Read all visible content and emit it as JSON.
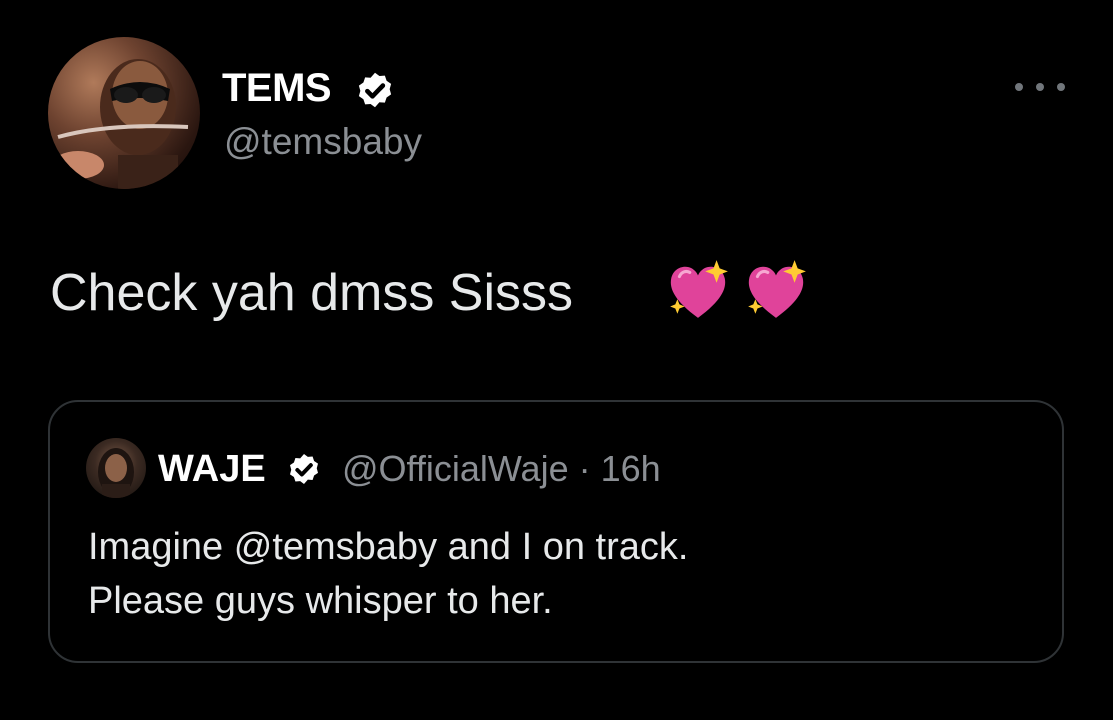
{
  "tweet": {
    "author": {
      "display_name": "TEMS",
      "handle": "@temsbaby",
      "verified": true,
      "avatar_icon": "profile-photo"
    },
    "more_icon": "more-horizontal-icon",
    "text": "Check yah dmss Sisss",
    "emojis": [
      "sparkling-heart-emoji",
      "sparkling-heart-emoji"
    ]
  },
  "quoted_tweet": {
    "author": {
      "display_name": "WAJE",
      "handle": "@OfficialWaje",
      "verified": true,
      "avatar_icon": "profile-photo"
    },
    "separator": "·",
    "time": "16h",
    "lines": [
      "Imagine @temsbaby and I on track.",
      "Please guys whisper to her."
    ]
  },
  "colors": {
    "background": "#000000",
    "text_primary": "#e7e9ea",
    "text_secondary": "#8b8f94",
    "border": "#2f3336",
    "emoji_heart": "#e0439a"
  }
}
